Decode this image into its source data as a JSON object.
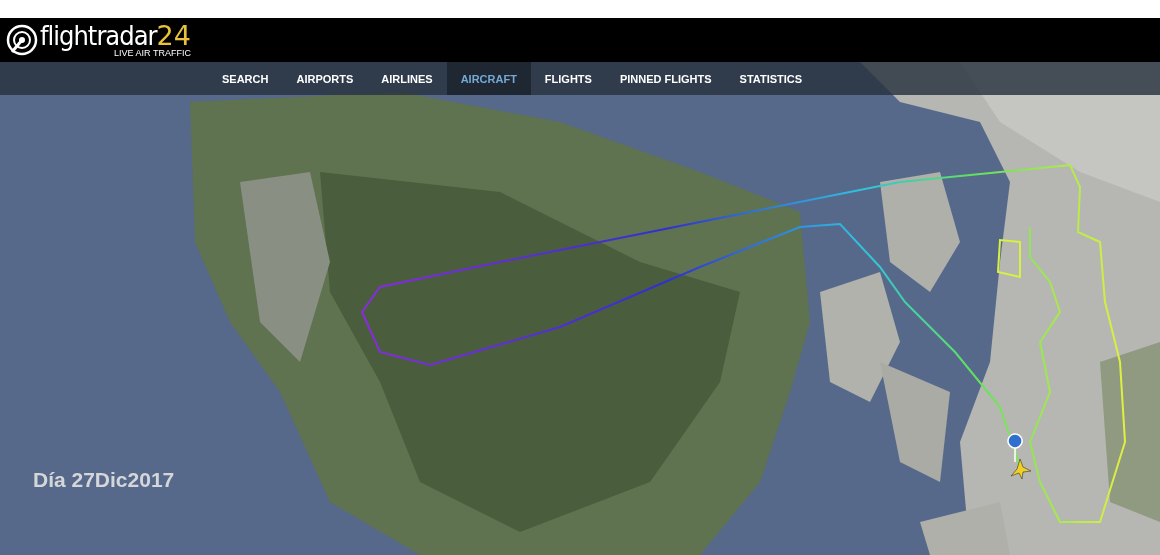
{
  "logo": {
    "name": "flightradar",
    "number": "24",
    "tagline": "LIVE AIR TRAFFIC"
  },
  "nav": [
    {
      "label": "SEARCH",
      "selected": false
    },
    {
      "label": "AIRPORTS",
      "selected": false
    },
    {
      "label": "AIRLINES",
      "selected": false
    },
    {
      "label": "AIRCRAFT",
      "selected": true
    },
    {
      "label": "FLIGHTS",
      "selected": false
    },
    {
      "label": "PINNED FLIGHTS",
      "selected": false
    },
    {
      "label": "STATISTICS",
      "selected": false
    }
  ],
  "map": {
    "kind": "picture",
    "caption": "Día 27Dic2017"
  }
}
